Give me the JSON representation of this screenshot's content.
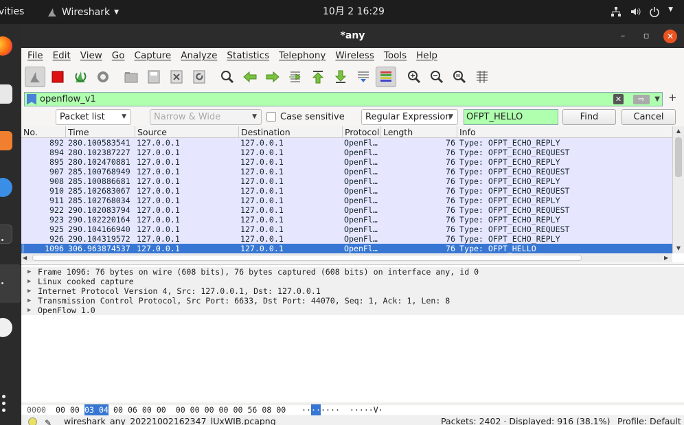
{
  "topbar": {
    "activities": "ivities",
    "app_name": "Wireshark",
    "clock": "10月 2  16:29"
  },
  "window": {
    "title": "*any"
  },
  "menu": [
    "File",
    "Edit",
    "View",
    "Go",
    "Capture",
    "Analyze",
    "Statistics",
    "Telephony",
    "Wireless",
    "Tools",
    "Help"
  ],
  "toolbar": {
    "icons": [
      "shark-fin-icon",
      "stop-icon",
      "restart-icon",
      "options-gear-icon",
      "open-file-icon",
      "save-file-icon",
      "close-file-icon",
      "reload-icon",
      "find-icon",
      "back-arrow-icon",
      "forward-arrow-icon",
      "go-to-packet-icon",
      "first-packet-icon",
      "last-packet-icon",
      "autoscroll-icon",
      "colorize-icon",
      "zoom-in-icon",
      "zoom-out-icon",
      "normal-size-icon",
      "resize-columns-icon"
    ]
  },
  "display_filter": {
    "value": "openflow_v1"
  },
  "find": {
    "search_in": "Packet list",
    "char_width": "Narrow & Wide",
    "case_sensitive_label": "Case sensitive",
    "search_type": "Regular Expression",
    "value": "OFPT_HELLO",
    "find_button": "Find",
    "cancel_button": "Cancel"
  },
  "packet_list": {
    "columns": [
      "No.",
      "Time",
      "Source",
      "Destination",
      "Protocol",
      "Length",
      "Info"
    ],
    "rows": [
      {
        "no": "892",
        "time": "280.100583541",
        "src": "127.0.0.1",
        "dst": "127.0.0.1",
        "proto": "OpenFl…",
        "len": "76",
        "info": "Type: OFPT_ECHO_REPLY"
      },
      {
        "no": "894",
        "time": "280.102387227",
        "src": "127.0.0.1",
        "dst": "127.0.0.1",
        "proto": "OpenFl…",
        "len": "76",
        "info": "Type: OFPT_ECHO_REQUEST"
      },
      {
        "no": "895",
        "time": "280.102470881",
        "src": "127.0.0.1",
        "dst": "127.0.0.1",
        "proto": "OpenFl…",
        "len": "76",
        "info": "Type: OFPT_ECHO_REPLY"
      },
      {
        "no": "907",
        "time": "285.100768949",
        "src": "127.0.0.1",
        "dst": "127.0.0.1",
        "proto": "OpenFl…",
        "len": "76",
        "info": "Type: OFPT_ECHO_REQUEST"
      },
      {
        "no": "908",
        "time": "285.100886681",
        "src": "127.0.0.1",
        "dst": "127.0.0.1",
        "proto": "OpenFl…",
        "len": "76",
        "info": "Type: OFPT_ECHO_REPLY"
      },
      {
        "no": "910",
        "time": "285.102683067",
        "src": "127.0.0.1",
        "dst": "127.0.0.1",
        "proto": "OpenFl…",
        "len": "76",
        "info": "Type: OFPT_ECHO_REQUEST"
      },
      {
        "no": "911",
        "time": "285.102768034",
        "src": "127.0.0.1",
        "dst": "127.0.0.1",
        "proto": "OpenFl…",
        "len": "76",
        "info": "Type: OFPT_ECHO_REPLY"
      },
      {
        "no": "922",
        "time": "290.102083794",
        "src": "127.0.0.1",
        "dst": "127.0.0.1",
        "proto": "OpenFl…",
        "len": "76",
        "info": "Type: OFPT_ECHO_REQUEST"
      },
      {
        "no": "923",
        "time": "290.102220164",
        "src": "127.0.0.1",
        "dst": "127.0.0.1",
        "proto": "OpenFl…",
        "len": "76",
        "info": "Type: OFPT_ECHO_REPLY"
      },
      {
        "no": "925",
        "time": "290.104166940",
        "src": "127.0.0.1",
        "dst": "127.0.0.1",
        "proto": "OpenFl…",
        "len": "76",
        "info": "Type: OFPT_ECHO_REQUEST"
      },
      {
        "no": "926",
        "time": "290.104319572",
        "src": "127.0.0.1",
        "dst": "127.0.0.1",
        "proto": "OpenFl…",
        "len": "76",
        "info": "Type: OFPT_ECHO_REPLY"
      },
      {
        "no": "1096",
        "time": "306.963874537",
        "src": "127.0.0.1",
        "dst": "127.0.0.1",
        "proto": "OpenFl…",
        "len": "76",
        "info": "Type: OFPT_HELLO",
        "selected": true
      }
    ]
  },
  "details": [
    "Frame 1096: 76 bytes on wire (608 bits), 76 bytes captured (608 bits) on interface any, id 0",
    "Linux cooked capture",
    "Internet Protocol Version 4, Src: 127.0.0.1, Dst: 127.0.0.1",
    "Transmission Control Protocol, Src Port: 6633, Dst Port: 44070, Seq: 1, Ack: 1, Len: 8",
    "OpenFlow 1.0"
  ],
  "bytes": {
    "offset": "0000",
    "hex_before": "00 00",
    "hex_selected": "03 04",
    "hex_after": "00 06 00 00  00 00 00 00 00 56 08 00",
    "ascii_before": "··",
    "ascii_selected": "··",
    "ascii_after": "····  ·····V·"
  },
  "status": {
    "file": "wireshark_any_20221002162347_lUxWIB.pcapng",
    "packets": "Packets: 2402 · Displayed: 916 (38.1%)",
    "profile": "Profile: Default"
  },
  "colors": {
    "filter_valid": "#afffaf",
    "row_openflow": "#e7e6ff",
    "row_selected": "#3777d3",
    "close_button": "#e95420"
  }
}
